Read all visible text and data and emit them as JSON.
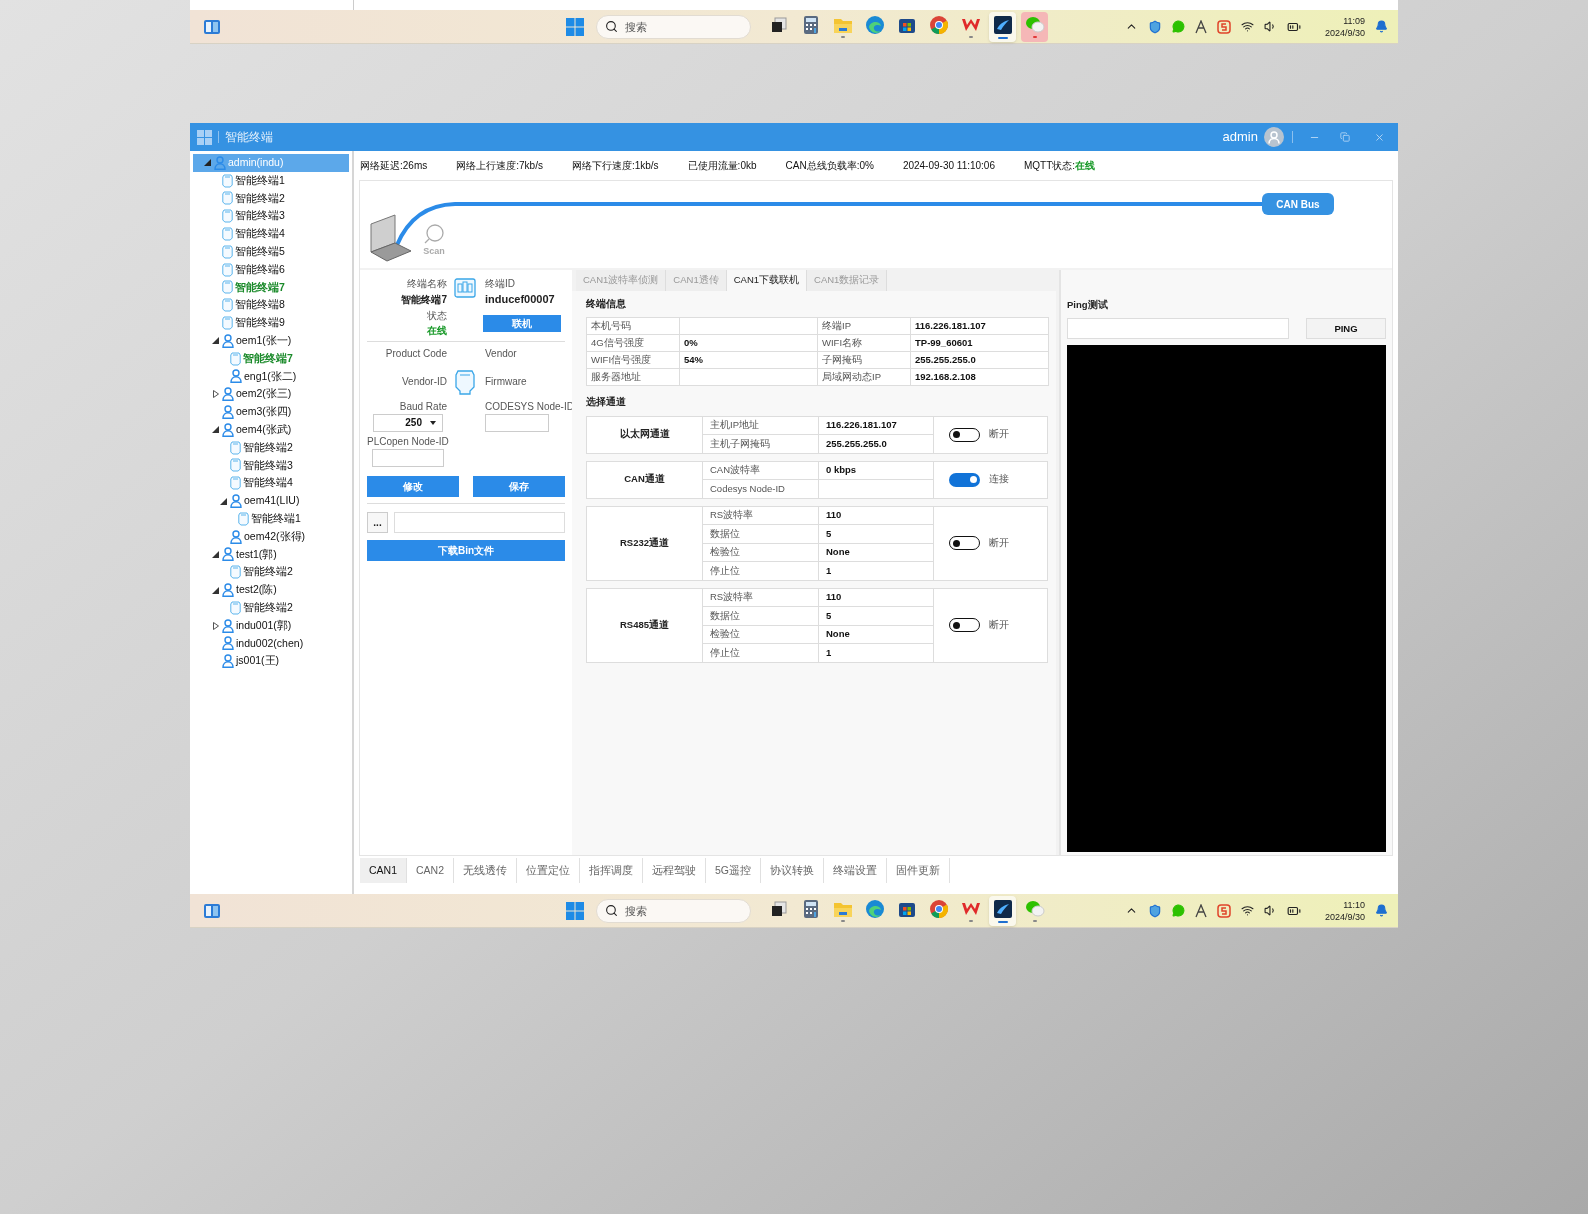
{
  "taskbars": [
    {
      "search_placeholder": "搜索",
      "time": "11:09",
      "date": "2024/9/30",
      "apps": [
        {
          "kind": "taskview",
          "running": false,
          "focused": false,
          "alert": false
        },
        {
          "kind": "calculator",
          "running": false,
          "focused": false,
          "alert": false
        },
        {
          "kind": "files",
          "running": true,
          "focused": false,
          "alert": false
        },
        {
          "kind": "edge",
          "running": false,
          "focused": false,
          "alert": false
        },
        {
          "kind": "store",
          "running": false,
          "focused": false,
          "alert": false
        },
        {
          "kind": "chrome",
          "running": false,
          "focused": false,
          "alert": false
        },
        {
          "kind": "wps",
          "running": true,
          "focused": false,
          "alert": false
        },
        {
          "kind": "terminal",
          "running": true,
          "focused": true,
          "alert": false
        },
        {
          "kind": "chat",
          "running": true,
          "focused": false,
          "alert": true
        }
      ]
    },
    {
      "search_placeholder": "搜索",
      "time": "11:10",
      "date": "2024/9/30",
      "apps": [
        {
          "kind": "taskview",
          "running": false,
          "focused": false,
          "alert": false
        },
        {
          "kind": "calculator",
          "running": false,
          "focused": false,
          "alert": false
        },
        {
          "kind": "files",
          "running": true,
          "focused": false,
          "alert": false
        },
        {
          "kind": "edge",
          "running": false,
          "focused": false,
          "alert": false
        },
        {
          "kind": "store",
          "running": false,
          "focused": false,
          "alert": false
        },
        {
          "kind": "chrome",
          "running": false,
          "focused": false,
          "alert": false
        },
        {
          "kind": "wps",
          "running": true,
          "focused": false,
          "alert": false
        },
        {
          "kind": "terminal",
          "running": true,
          "focused": true,
          "alert": false
        },
        {
          "kind": "chat",
          "running": true,
          "focused": false,
          "alert": false
        }
      ]
    }
  ],
  "window": {
    "title": "智能终端",
    "user": "admin"
  },
  "tree": [
    {
      "kind": "user",
      "label": "admin(indu)",
      "expanded": true,
      "selected": true,
      "highlighted": false,
      "children": [
        {
          "kind": "device",
          "label": "智能终端1",
          "selected": false,
          "highlighted": false
        },
        {
          "kind": "device",
          "label": "智能终端2",
          "selected": false,
          "highlighted": false
        },
        {
          "kind": "device",
          "label": "智能终端3",
          "selected": false,
          "highlighted": false
        },
        {
          "kind": "device",
          "label": "智能终端4",
          "selected": false,
          "highlighted": false
        },
        {
          "kind": "device",
          "label": "智能终端5",
          "selected": false,
          "highlighted": false
        },
        {
          "kind": "device",
          "label": "智能终端6",
          "selected": false,
          "highlighted": false
        },
        {
          "kind": "device",
          "label": "智能终端7",
          "selected": false,
          "highlighted": true
        },
        {
          "kind": "device",
          "label": "智能终端8",
          "selected": false,
          "highlighted": false
        },
        {
          "kind": "device",
          "label": "智能终端9",
          "selected": false,
          "highlighted": false
        },
        {
          "kind": "user",
          "label": "oem1(张一)",
          "expanded": true,
          "selected": false,
          "highlighted": false,
          "children": [
            {
              "kind": "device",
              "label": "智能终端7",
              "selected": false,
              "highlighted": true
            },
            {
              "kind": "user",
              "label": "eng1(张二)",
              "selected": false,
              "highlighted": false
            }
          ]
        },
        {
          "kind": "user",
          "label": "oem2(张三)",
          "expanded": false,
          "selected": false,
          "highlighted": false
        },
        {
          "kind": "user",
          "label": "oem3(张四)",
          "selected": false,
          "highlighted": false
        },
        {
          "kind": "user",
          "label": "oem4(张武)",
          "expanded": true,
          "selected": false,
          "highlighted": false,
          "children": [
            {
              "kind": "device",
              "label": "智能终端2",
              "selected": false,
              "highlighted": false
            },
            {
              "kind": "device",
              "label": "智能终端3",
              "selected": false,
              "highlighted": false
            },
            {
              "kind": "device",
              "label": "智能终端4",
              "selected": false,
              "highlighted": false
            },
            {
              "kind": "user",
              "label": "oem41(LIU)",
              "expanded": true,
              "selected": false,
              "highlighted": false,
              "children": [
                {
                  "kind": "device",
                  "label": "智能终端1",
                  "selected": false,
                  "highlighted": false
                }
              ]
            },
            {
              "kind": "user",
              "label": "oem42(张得)",
              "selected": false,
              "highlighted": false
            }
          ]
        },
        {
          "kind": "user",
          "label": "test1(郭)",
          "expanded": true,
          "selected": false,
          "highlighted": false,
          "children": [
            {
              "kind": "device",
              "label": "智能终端2",
              "selected": false,
              "highlighted": false
            }
          ]
        },
        {
          "kind": "user",
          "label": "test2(陈)",
          "expanded": true,
          "selected": false,
          "highlighted": false,
          "children": [
            {
              "kind": "device",
              "label": "智能终端2",
              "selected": false,
              "highlighted": false
            }
          ]
        },
        {
          "kind": "user",
          "label": "indu001(郭)",
          "expanded": false,
          "selected": false,
          "highlighted": false
        },
        {
          "kind": "user",
          "label": "indu002(chen)",
          "selected": false,
          "highlighted": false
        },
        {
          "kind": "user",
          "label": "js001(王)",
          "selected": false,
          "highlighted": false
        }
      ]
    }
  ],
  "status_bar": [
    {
      "text": "网络延迟:26ms"
    },
    {
      "text": "网络上行速度:7kb/s"
    },
    {
      "text": "网络下行速度:1kb/s"
    },
    {
      "text": "已使用流量:0kb"
    },
    {
      "text": "CAN总线负载率:0%"
    },
    {
      "text": "2024-09-30 11:10:06"
    },
    {
      "text": "MQTT状态:",
      "value": "在线"
    }
  ],
  "diagram": {
    "scan_label": "Scan",
    "bus_label": "CAN Bus"
  },
  "device": {
    "name_label": "终端名称",
    "name": "智能终端7",
    "status_label": "状态",
    "status": "在线",
    "id_label": "终端ID",
    "id": "inducef00007",
    "connect_button": "联机",
    "product_code_label": "Product Code",
    "vendor_label": "Vendor",
    "vendor_id_label": "Vendor-ID",
    "firmware_label": "Firmware",
    "baud_rate_label": "Baud Rate",
    "baud_rate": "250",
    "codesys_label": "CODESYS Node-ID",
    "plcopen_label": "PLCopen Node-ID",
    "edit_button": "修改",
    "save_button": "保存",
    "browse_button": "...",
    "download_button": "下载Bin文件"
  },
  "tabs": [
    {
      "label": "CAN1波特率侦测",
      "selected": false
    },
    {
      "label": "CAN1透传",
      "selected": false
    },
    {
      "label": "CAN1下载联机",
      "selected": true
    },
    {
      "label": "CAN1数据记录",
      "selected": false
    }
  ],
  "terminal_info": {
    "title": "终端信息",
    "rows": [
      {
        "cells": [
          {
            "label": "本机号码"
          },
          {
            "label": "终端IP",
            "value": "116.226.181.107"
          }
        ]
      },
      {
        "cells": [
          {
            "label": "4G信号强度",
            "value": "0%"
          },
          {
            "label": "WIFI名称",
            "value": "TP-99_60601"
          }
        ]
      },
      {
        "cells": [
          {
            "label": "WIFI信号强度",
            "value": "54%"
          },
          {
            "label": "子网掩码",
            "value": "255.255.255.0"
          }
        ]
      },
      {
        "cells": [
          {
            "label": "服务器地址"
          },
          {
            "label": "局域网动态IP",
            "value": "192.168.2.108"
          }
        ]
      }
    ]
  },
  "channels": {
    "title": "选择通道",
    "list": [
      {
        "name": "以太网通道",
        "on": false,
        "state_label": "断开",
        "params": [
          {
            "label": "主机IP地址",
            "value": "116.226.181.107"
          },
          {
            "label": "主机子网掩码",
            "value": "255.255.255.0"
          }
        ]
      },
      {
        "name": "CAN通道",
        "on": true,
        "state_label": "连接",
        "params": [
          {
            "label": "CAN波特率",
            "value": "0 kbps"
          },
          {
            "label": "Codesys Node-ID"
          }
        ]
      },
      {
        "name": "RS232通道",
        "on": false,
        "state_label": "断开",
        "params": [
          {
            "label": "RS波特率",
            "value": "110"
          },
          {
            "label": "数据位",
            "value": "5"
          },
          {
            "label": "检验位",
            "value": "None"
          },
          {
            "label": "停止位",
            "value": "1"
          }
        ]
      },
      {
        "name": "RS485通道",
        "on": false,
        "state_label": "断开",
        "params": [
          {
            "label": "RS波特率",
            "value": "110"
          },
          {
            "label": "数据位",
            "value": "5"
          },
          {
            "label": "检验位",
            "value": "None"
          },
          {
            "label": "停止位",
            "value": "1"
          }
        ]
      }
    ]
  },
  "ping": {
    "title": "Ping测试",
    "button": "PING"
  },
  "bottom_tabs": [
    {
      "label": "CAN1",
      "selected": true
    },
    {
      "label": "CAN2",
      "selected": false
    },
    {
      "label": "无线透传",
      "selected": false
    },
    {
      "label": "位置定位",
      "selected": false
    },
    {
      "label": "指挥调度",
      "selected": false
    },
    {
      "label": "远程驾驶",
      "selected": false
    },
    {
      "label": "5G遥控",
      "selected": false
    },
    {
      "label": "协议转换",
      "selected": false
    },
    {
      "label": "终端设置",
      "selected": false
    },
    {
      "label": "固件更新",
      "selected": false
    }
  ]
}
